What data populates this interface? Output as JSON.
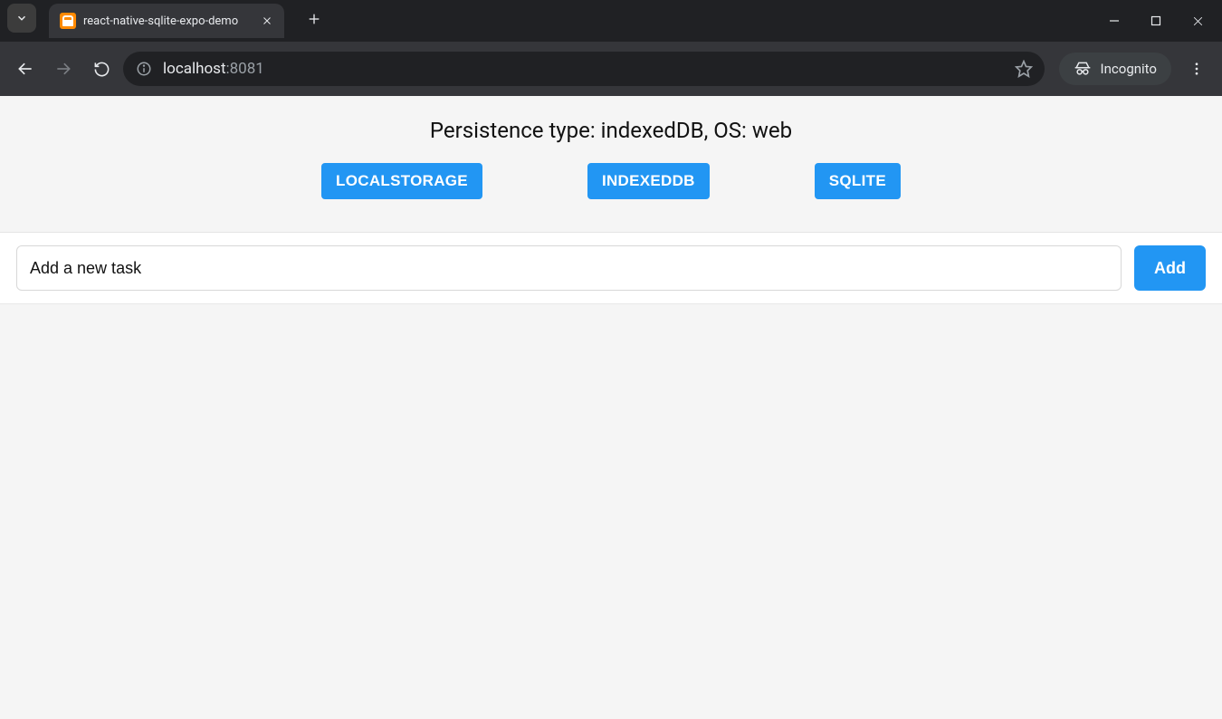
{
  "browser": {
    "tab_title": "react-native-sqlite-expo-demo",
    "url_host": "localhost",
    "url_port": ":8081",
    "incognito_label": "Incognito"
  },
  "header": {
    "title": "Persistence type: indexedDB, OS: web",
    "buttons": {
      "localstorage": "LOCALSTORAGE",
      "indexeddb": "INDEXEDDB",
      "sqlite": "SQLITE"
    }
  },
  "task": {
    "placeholder": "Add a new task",
    "add_label": "Add"
  }
}
